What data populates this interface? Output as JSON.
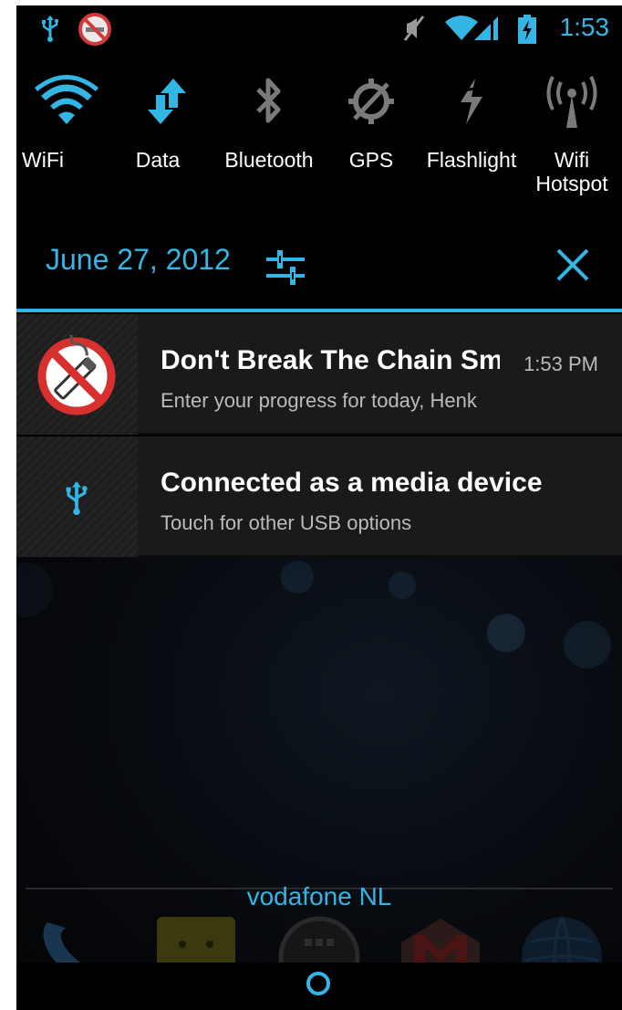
{
  "status_bar": {
    "time": "1:53",
    "left_icons": [
      "usb-icon",
      "no-smoking-icon"
    ],
    "right_icons": [
      "mute-icon",
      "wifi-signal-icon",
      "cell-signal-icon",
      "battery-charging-icon"
    ]
  },
  "quick_toggles": [
    {
      "label": "WiFi",
      "icon": "wifi-icon",
      "active": true
    },
    {
      "label": "Data",
      "icon": "data-arrows-icon",
      "active": true
    },
    {
      "label": "Bluetooth",
      "icon": "bluetooth-icon",
      "active": false
    },
    {
      "label": "GPS",
      "icon": "gps-icon",
      "active": false
    },
    {
      "label": "Flashlight",
      "icon": "flashlight-icon",
      "active": false
    },
    {
      "label": "Wifi Hotspot",
      "icon": "hotspot-icon",
      "active": false
    }
  ],
  "header": {
    "date": "June 27, 2012",
    "settings_icon": "settings-sliders-icon",
    "clear_icon": "close-icon"
  },
  "notifications": [
    {
      "title": "Don't Break The Chain Smoking",
      "subtitle": "Enter your progress for today, Henk",
      "time": "1:53 PM",
      "icon": "no-smoking-icon"
    },
    {
      "title": "Connected as a media device",
      "subtitle": "Touch for other USB options",
      "time": "",
      "icon": "usb-icon"
    }
  ],
  "home": {
    "carrier": "vodafone NL",
    "dock_icons": [
      "phone-icon",
      "messaging-icon",
      "app-drawer-icon",
      "gmail-icon",
      "browser-icon"
    ]
  },
  "colors": {
    "accent": "#33b5e5",
    "notification_bg": "#1a1a1a",
    "background": "#000000"
  }
}
